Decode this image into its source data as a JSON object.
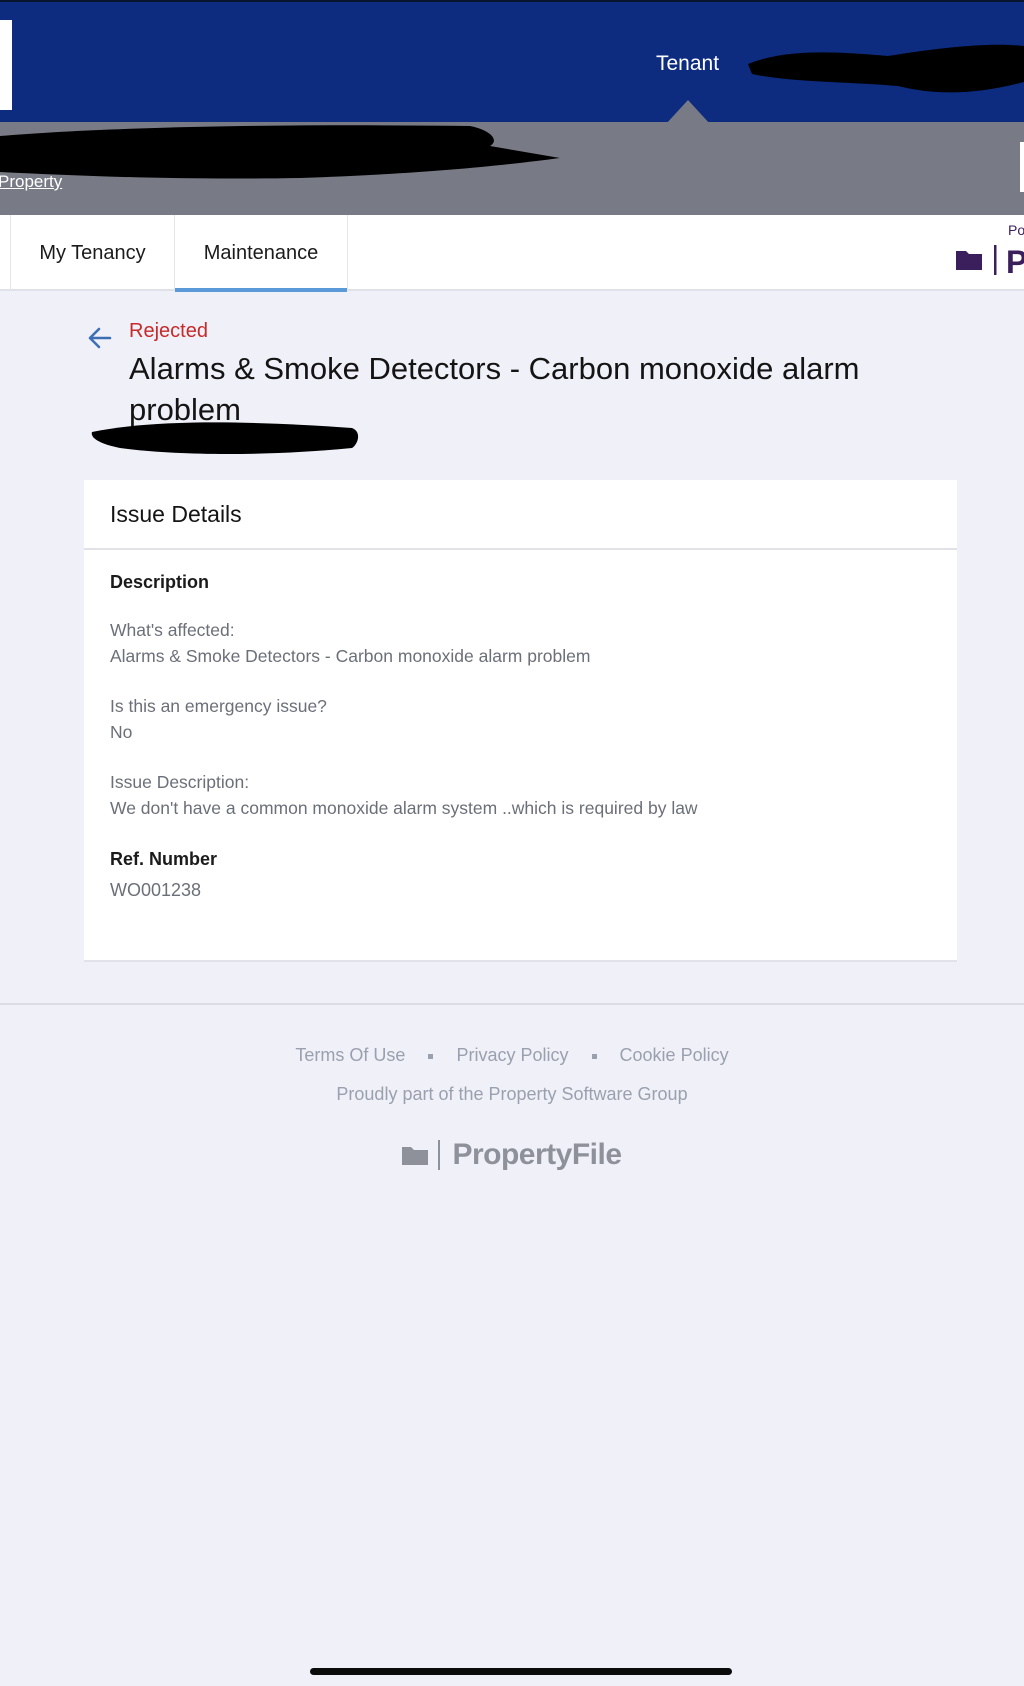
{
  "header": {
    "role_label": "Tenant",
    "property_link": "Property"
  },
  "tabs": [
    {
      "label": "My Tenancy",
      "active": false
    },
    {
      "label": "Maintenance",
      "active": true
    }
  ],
  "brand_partial": {
    "text": "Po",
    "letter": "P",
    "color": "#3b1f5c"
  },
  "issue": {
    "status": "Rejected",
    "status_color": "#c62a2a",
    "title": "Alarms & Smoke Detectors - Carbon monoxide alarm problem"
  },
  "card": {
    "header": "Issue Details",
    "description_title": "Description",
    "affected_q": "What's affected:",
    "affected_a": "Alarms & Smoke Detectors - Carbon monoxide alarm problem",
    "emergency_q": "Is this an emergency issue?",
    "emergency_a": "No",
    "issue_desc_q": "Issue Description:",
    "issue_desc_a": "We don't have a common monoxide alarm system ..which is required by law",
    "ref_title": "Ref. Number",
    "ref_value": "WO001238"
  },
  "footer": {
    "links": [
      "Terms Of Use",
      "Privacy Policy",
      "Cookie Policy"
    ],
    "tagline": "Proudly part of the Property Software Group",
    "brand": "PropertyFile"
  },
  "colors": {
    "topbar": "#0d2c80",
    "propbar": "#787b85",
    "background": "#f0f1f8",
    "tab_underline": "#5b9ad8"
  }
}
